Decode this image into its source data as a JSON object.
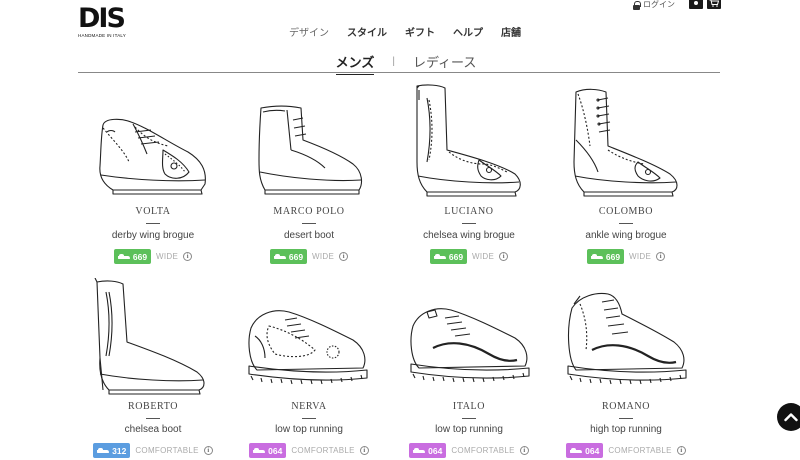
{
  "brand": {
    "logo": "DIS",
    "tagline": "HANDMADE IN ITALY"
  },
  "topbar": {
    "login_label": "ログイン",
    "flag_icon": "japan-flag-icon",
    "cart_icon": "cart-icon"
  },
  "nav": {
    "items": [
      "デザイン",
      "スタイル",
      "ギフト",
      "ヘルプ",
      "店舗"
    ]
  },
  "tabs": {
    "items": [
      "メンズ",
      "レディース"
    ],
    "separator": "|",
    "active": "メンズ"
  },
  "colors": {
    "green": "#5cc05a",
    "blue": "#5b9de0",
    "purple": "#c96de0"
  },
  "products": [
    {
      "name": "VOLTA",
      "desc": "derby wing brogue",
      "code": "669",
      "fit": "WIDE",
      "badge_color": "green"
    },
    {
      "name": "MARCO POLO",
      "desc": "desert boot",
      "code": "669",
      "fit": "WIDE",
      "badge_color": "green"
    },
    {
      "name": "LUCIANO",
      "desc": "chelsea wing brogue",
      "code": "669",
      "fit": "WIDE",
      "badge_color": "green"
    },
    {
      "name": "COLOMBO",
      "desc": "ankle wing brogue",
      "code": "669",
      "fit": "WIDE",
      "badge_color": "green"
    },
    {
      "name": "ROBERTO",
      "desc": "chelsea boot",
      "code": "312",
      "fit": "COMFORTABLE",
      "badge_color": "blue"
    },
    {
      "name": "NERVA",
      "desc": "low top running",
      "code": "064",
      "fit": "COMFORTABLE",
      "badge_color": "purple"
    },
    {
      "name": "ITALO",
      "desc": "low top running",
      "code": "064",
      "fit": "COMFORTABLE",
      "badge_color": "purple"
    },
    {
      "name": "ROMANO",
      "desc": "high top running",
      "code": "064",
      "fit": "COMFORTABLE",
      "badge_color": "purple"
    }
  ]
}
